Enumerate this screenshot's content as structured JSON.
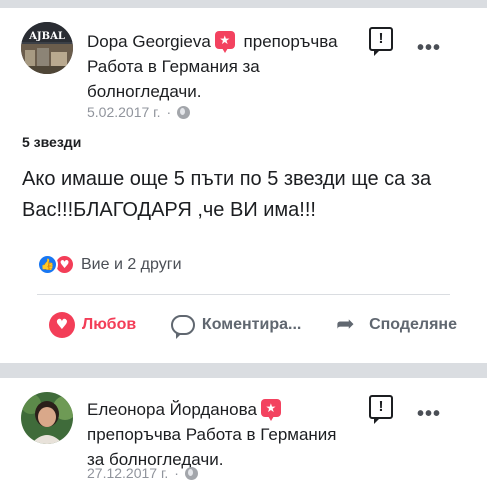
{
  "post1": {
    "author": "Dopa Georgieva",
    "action_text": "препоръчва Работа в Германия за болногледачи.",
    "date": "5.02.2017 г.",
    "separator": "·",
    "rating_label": "5 звезди",
    "review": "Ако имаше още 5 пъти по 5 звезди ще са за Вас!!!БЛАГОДАРЯ ,че ВИ има!!!",
    "reactions_text": "Вие и 2 други",
    "actions": {
      "love": "Любов",
      "comment": "Коментира...",
      "share": "Споделяне"
    }
  },
  "post2": {
    "author": "Елеонора Йорданова",
    "action_text": "препоръчва Работа в Германия за болногледачи.",
    "date": "27.12.2017 г.",
    "separator": "·"
  },
  "icons": {
    "report": "!",
    "more": "•••",
    "like": "👍",
    "love": "♥",
    "share": "➦"
  },
  "colors": {
    "accent_red": "#f33e58",
    "like_blue": "#1877f2",
    "muted": "#90949c",
    "background": "#dadde1"
  }
}
